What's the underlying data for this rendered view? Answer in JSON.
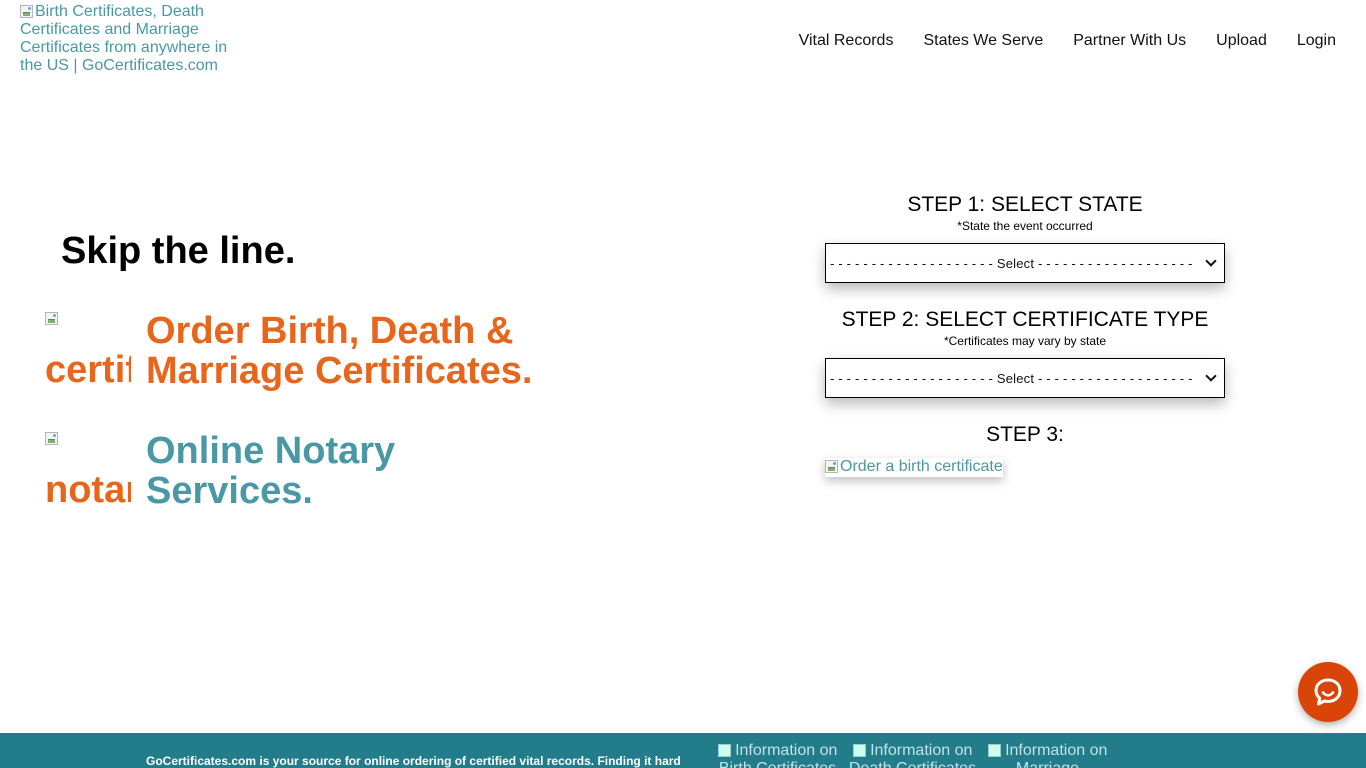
{
  "header": {
    "logo_alt": "Birth Certificates, Death Certificates and Marriage Certificates from anywhere in the US | GoCertificates.com",
    "nav": [
      "Vital Records",
      "States We Serve",
      "Partner With Us",
      "Upload",
      "Login"
    ]
  },
  "hero": {
    "title": "Skip the line.",
    "feature1_icon_alt": "certificate copies",
    "feature1_line1": "Order Birth, Death &",
    "feature1_line2": "Marriage Certificates.",
    "feature2_icon_alt": "notary online",
    "feature2_line1": "Online Notary",
    "feature2_line2": "Services."
  },
  "steps": {
    "step1_title": "STEP 1: SELECT STATE",
    "step1_sub": "*State the event occurred",
    "step1_select": "- - - - - - - - - - - - - - - - - - - - Select - - - - - - - - - - - - - - - - - - -",
    "step2_title": "STEP 2: SELECT CERTIFICATE TYPE",
    "step2_sub": "*Certificates may vary by state",
    "step2_select": "- - - - - - - - - - - - - - - - - - - - Select - - - - - - - - - - - - - - - - - - -",
    "step3_title": "STEP 3:",
    "step3_button_alt": "Order a birth certificate"
  },
  "footer": {
    "text": "GoCertificates.com is your source for online ordering of certified vital records. Finding it hard",
    "links": [
      "Information on Birth Certificates",
      "Information on Death Certificates",
      "Information on Marriage Certificates"
    ]
  },
  "colors": {
    "accent_orange": "#e8661b",
    "accent_teal": "#4a98a6",
    "footer_bg": "#227c8a",
    "chat_bg": "#d94408"
  },
  "icons": {
    "chat": "chat-bubble-icon"
  }
}
